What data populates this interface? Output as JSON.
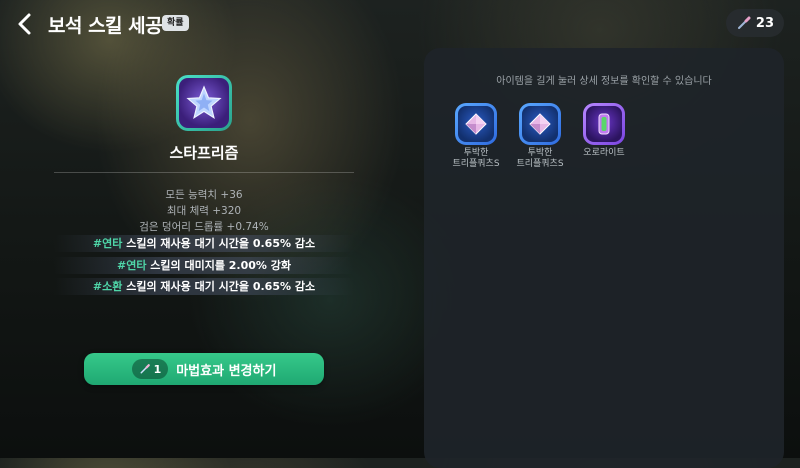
{
  "header": {
    "title": "보석 스킬 세공",
    "badge": "확률",
    "currency_amount": "23"
  },
  "prism": {
    "name": "스타프리즘",
    "stats": [
      "모든 능력치 +36",
      "최대 체력 +320",
      "검은 덩어리 드롭률 +0.74%"
    ],
    "effects": [
      {
        "tag": "#연타",
        "text": " 스킬의 재사용 대기 시간을 0.65% 감소"
      },
      {
        "tag": "#연타",
        "text": " 스킬의 대미지를 2.00% 강화"
      },
      {
        "tag": "#소환",
        "text": " 스킬의 재사용 대기 시간을 0.65% 감소"
      }
    ]
  },
  "change_button": {
    "cost": "1",
    "label": "마법효과 변경하기"
  },
  "panel": {
    "hint": "아이템을 길게 눌러 상세 정보를 확인할 수 있습니다",
    "items": [
      {
        "name": "투박한\n트리플쿼츠S",
        "icon": "diamond-gem-icon",
        "rarity": "blue"
      },
      {
        "name": "투박한\n트리플쿼츠S",
        "icon": "diamond-gem-icon",
        "rarity": "blue"
      },
      {
        "name": "오로라이트",
        "icon": "aurora-crystal-icon",
        "rarity": "purple"
      }
    ]
  },
  "colors": {
    "accent_green": "#1fa872",
    "effect_tag": "#4fd6a8",
    "panel_bg": "#1e2429"
  }
}
